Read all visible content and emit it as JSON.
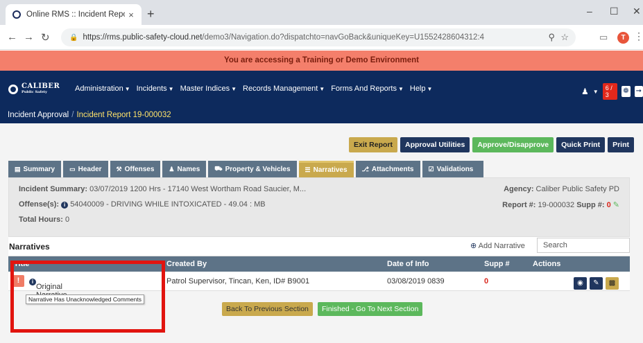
{
  "browser": {
    "tab_title": "Online RMS :: Incident Report",
    "tab_close": "×",
    "new_tab": "+",
    "url_host": "https://rms.public-safety-cloud.net",
    "url_path": "/demo3/Navigation.do?dispatchto=navGoBack&uniqueKey=U1552428604312:4",
    "profile_initial": "T"
  },
  "banner": {
    "text": "You are accessing a Training or Demo Environment",
    "color": "#f47f6b"
  },
  "header": {
    "brand": "CALIBER",
    "brand_sub": "Public Safety",
    "menu": [
      "Administration",
      "Incidents",
      "Master Indices",
      "Records Management",
      "Forms And Reports",
      "Help"
    ],
    "alert_count": "6 / 3",
    "breadcrumb_parent": "Incident Approval",
    "breadcrumb_sep": "/",
    "breadcrumb_current": "Incident Report 19-000032",
    "color": "#0d2a5d"
  },
  "actions": {
    "exit_report": "Exit Report",
    "approval_utilities": "Approval Utilities",
    "approve_disapprove": "Approve/Disapprove",
    "quick_print": "Quick Print",
    "print": "Print"
  },
  "tabs": [
    {
      "label": "Summary",
      "icon": "list-icon"
    },
    {
      "label": "Header",
      "icon": "window-icon"
    },
    {
      "label": "Offenses",
      "icon": "gavel-icon"
    },
    {
      "label": "Names",
      "icon": "user-icon"
    },
    {
      "label": "Property & Vehicles",
      "icon": "car-icon"
    },
    {
      "label": "Narratives",
      "icon": "text-icon"
    },
    {
      "label": "Attachments",
      "icon": "paperclip-icon"
    },
    {
      "label": "Validations",
      "icon": "checklist-icon"
    }
  ],
  "summary": {
    "incident_label": "Incident Summary:",
    "incident_value": "03/07/2019 1200 Hrs - 17140 West Wortham Road Saucier, M...",
    "offense_label": "Offense(s):",
    "offense_value": "54040009 - DRIVING WHILE INTOXICATED - 49.04 : MB",
    "total_hours_label": "Total Hours:",
    "total_hours_value": "0",
    "agency_label": "Agency:",
    "agency_value": "Caliber Public Safety PD",
    "report_label": "Report #:",
    "report_value": "19-000032",
    "supp_label": "Supp #:",
    "supp_value": "0"
  },
  "narratives": {
    "heading": "Narratives",
    "add_label": "Add Narrative",
    "search_placeholder": "Search",
    "columns": [
      "Title",
      "Created By",
      "Date of Info",
      "Supp #",
      "Actions"
    ],
    "rows": [
      {
        "title": "Original Narrative",
        "created_by": "Patrol Supervisor, Tincan, Ken, ID# B9001",
        "date": "03/08/2019 0839",
        "supp": "0"
      }
    ],
    "tooltip": "Narrative Has Unacknowledged Comments",
    "back_label": "Back To Previous Section",
    "next_label": "Finished - Go To Next Section"
  }
}
